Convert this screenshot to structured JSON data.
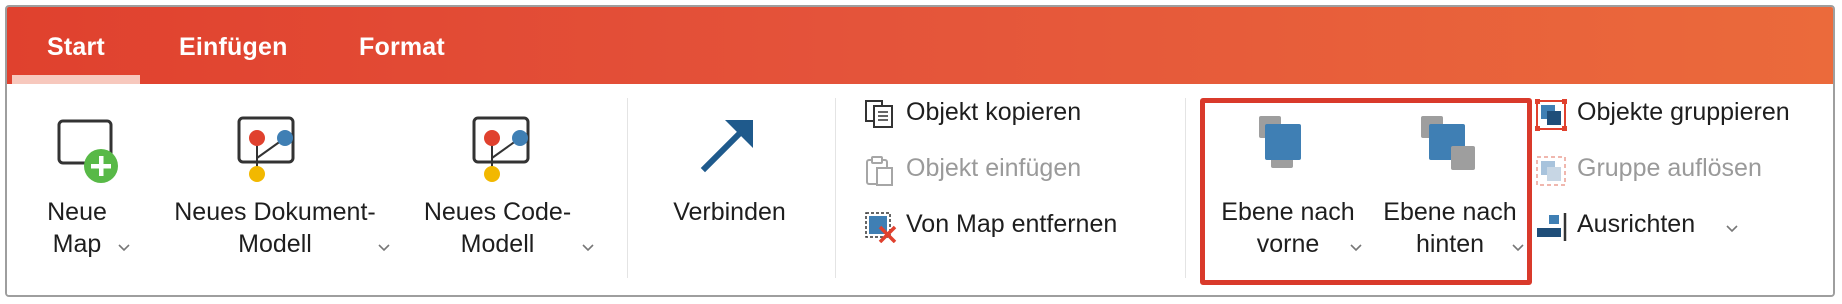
{
  "tabs": [
    {
      "label": "Start",
      "active": true
    },
    {
      "label": "Einfügen",
      "active": false
    },
    {
      "label": "Format",
      "active": false
    }
  ],
  "ribbon": {
    "new_map": {
      "line1": "Neue",
      "line2": "Map",
      "icon": "new-map-plus-icon"
    },
    "new_document_model": {
      "line1": "Neues Dokument-",
      "line2": "Modell",
      "icon": "document-model-icon"
    },
    "new_code_model": {
      "line1": "Neues Code-",
      "line2": "Modell",
      "icon": "code-model-icon"
    },
    "connect": {
      "label": "Verbinden",
      "icon": "arrow-up-right-icon"
    },
    "object_actions": [
      {
        "label": "Objekt kopieren",
        "enabled": true,
        "icon": "copy-icon"
      },
      {
        "label": "Objekt einfügen",
        "enabled": false,
        "icon": "paste-icon"
      },
      {
        "label": "Von Map entfernen",
        "enabled": true,
        "icon": "remove-from-map-icon"
      }
    ],
    "bring_forward": {
      "line1": "Ebene nach",
      "line2": "vorne",
      "icon": "bring-forward-icon"
    },
    "send_backward": {
      "line1": "Ebene nach",
      "line2": "hinten",
      "icon": "send-backward-icon"
    },
    "group_actions": [
      {
        "label": "Objekte gruppieren",
        "enabled": true,
        "icon": "group-icon"
      },
      {
        "label": "Gruppe auflösen",
        "enabled": false,
        "icon": "ungroup-icon"
      },
      {
        "label": "Ausrichten",
        "enabled": true,
        "icon": "align-icon",
        "has_dropdown": true
      }
    ]
  },
  "colors": {
    "accent_start": "#e0412e",
    "accent_end": "#eb6a3b",
    "highlight_border": "#d93a2b",
    "icon_blue": "#3f7fb4",
    "icon_gray": "#9e9e9e"
  }
}
